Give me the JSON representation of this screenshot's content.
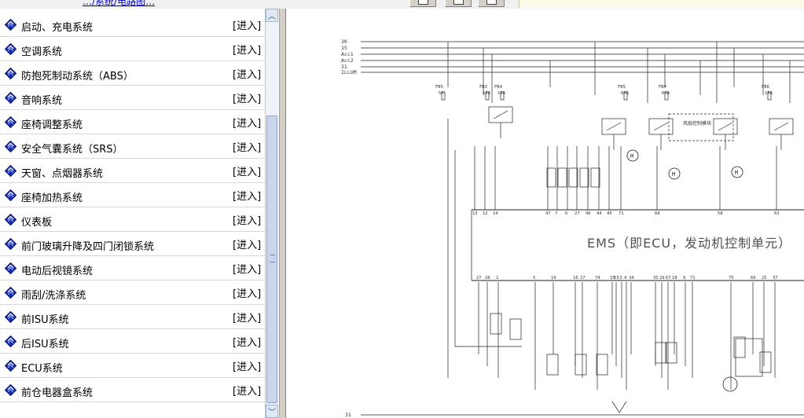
{
  "top_link": "…/系统/电路图…",
  "toolbar": {
    "buttons": [
      "btn1",
      "btn2",
      "btn3"
    ]
  },
  "menu": [
    {
      "label": "启动、充电系统",
      "enter": "[进入]"
    },
    {
      "label": "空调系统",
      "enter": "[进入]"
    },
    {
      "label": "防抱死制动系统（ABS）",
      "enter": "[进入]"
    },
    {
      "label": "音响系统",
      "enter": "[进入]"
    },
    {
      "label": "座椅调整系统",
      "enter": "[进入]"
    },
    {
      "label": "安全气囊系统（SRS）",
      "enter": "[进入]"
    },
    {
      "label": "天窗、点烟器系统",
      "enter": "[进入]"
    },
    {
      "label": "座椅加热系统",
      "enter": "[进入]"
    },
    {
      "label": "仪表板",
      "enter": "[进入]"
    },
    {
      "label": "前门玻璃升降及四门闭锁系统",
      "enter": "[进入]"
    },
    {
      "label": "电动后视镜系统",
      "enter": "[进入]"
    },
    {
      "label": "雨刮/洗涤系统",
      "enter": "[进入]"
    },
    {
      "label": "前ISU系统",
      "enter": "[进入]"
    },
    {
      "label": "后ISU系统",
      "enter": "[进入]"
    },
    {
      "label": "ECU系统",
      "enter": "[进入]"
    },
    {
      "label": "前仓电器盒系统",
      "enter": "[进入]"
    }
  ],
  "diagram": {
    "title": "EMS（即ECU，发动机控制单元）",
    "rails": [
      "30",
      "15",
      "Acc1",
      "Acc2",
      "31",
      "ILLUM"
    ],
    "bottom_rail": "31",
    "fuses": [
      "FB5 5A",
      "FB3 10A",
      "FB4 10A",
      "FB5 60A",
      "FB4 60A",
      "FB6 15A"
    ],
    "relay_labels": [
      "风扇控制模块"
    ],
    "connector_top_pins": [
      "13",
      "12",
      "14",
      "47",
      "7",
      "6",
      "27",
      "46",
      "44",
      "45",
      "71",
      "68",
      "58",
      "63"
    ],
    "connector_bottom_pins": [
      "27",
      "28",
      "2",
      "5",
      "19",
      "16",
      "17",
      "74",
      "15",
      "53",
      "3",
      "4",
      "34",
      "35",
      "29",
      "67",
      "18",
      "9",
      "71",
      "75",
      "60",
      "25",
      "37"
    ]
  },
  "icons": {
    "menu_bullet": "blue-diamond-book-icon",
    "scroll_up": "chevron-up-icon",
    "scroll_down": "chevron-down-icon"
  }
}
